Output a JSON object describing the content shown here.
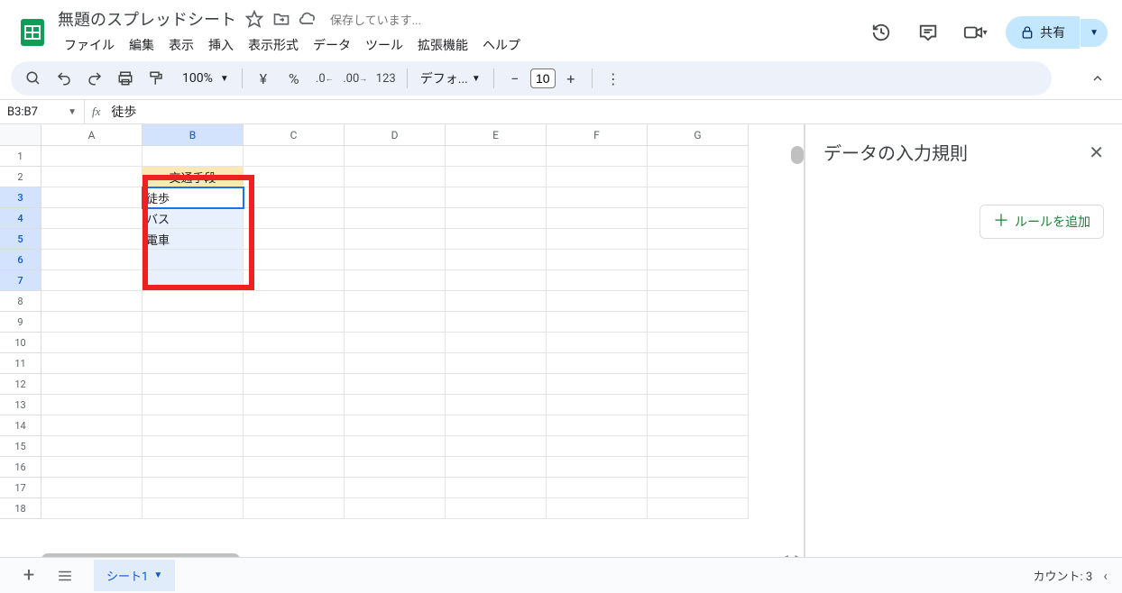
{
  "header": {
    "doc_title": "無題のスプレッドシート",
    "saving_text": "保存しています...",
    "share_label": "共有"
  },
  "menubar": [
    "ファイル",
    "編集",
    "表示",
    "挿入",
    "表示形式",
    "データ",
    "ツール",
    "拡張機能",
    "ヘルプ"
  ],
  "toolbar": {
    "zoom": "100%",
    "currency": "¥",
    "percent": "%",
    "dec_dec": ".0",
    "inc_dec": ".00",
    "numfmt": "123",
    "font_label": "デフォ...",
    "font_size": "10"
  },
  "namebox": "B3:B7",
  "formula_value": "徒歩",
  "columns": [
    "A",
    "B",
    "C",
    "D",
    "E",
    "F",
    "G"
  ],
  "rows_visible": 18,
  "selected_rows": [
    3,
    4,
    5,
    6,
    7
  ],
  "selected_col": "B",
  "cells": {
    "B2": "交通手段",
    "B3": "徒歩",
    "B4": "バス",
    "B5": "電車"
  },
  "side_panel": {
    "title": "データの入力規則",
    "add_rule_label": "ルールを追加"
  },
  "sheet_tab": "シート1",
  "footer_count": "カウント: 3"
}
